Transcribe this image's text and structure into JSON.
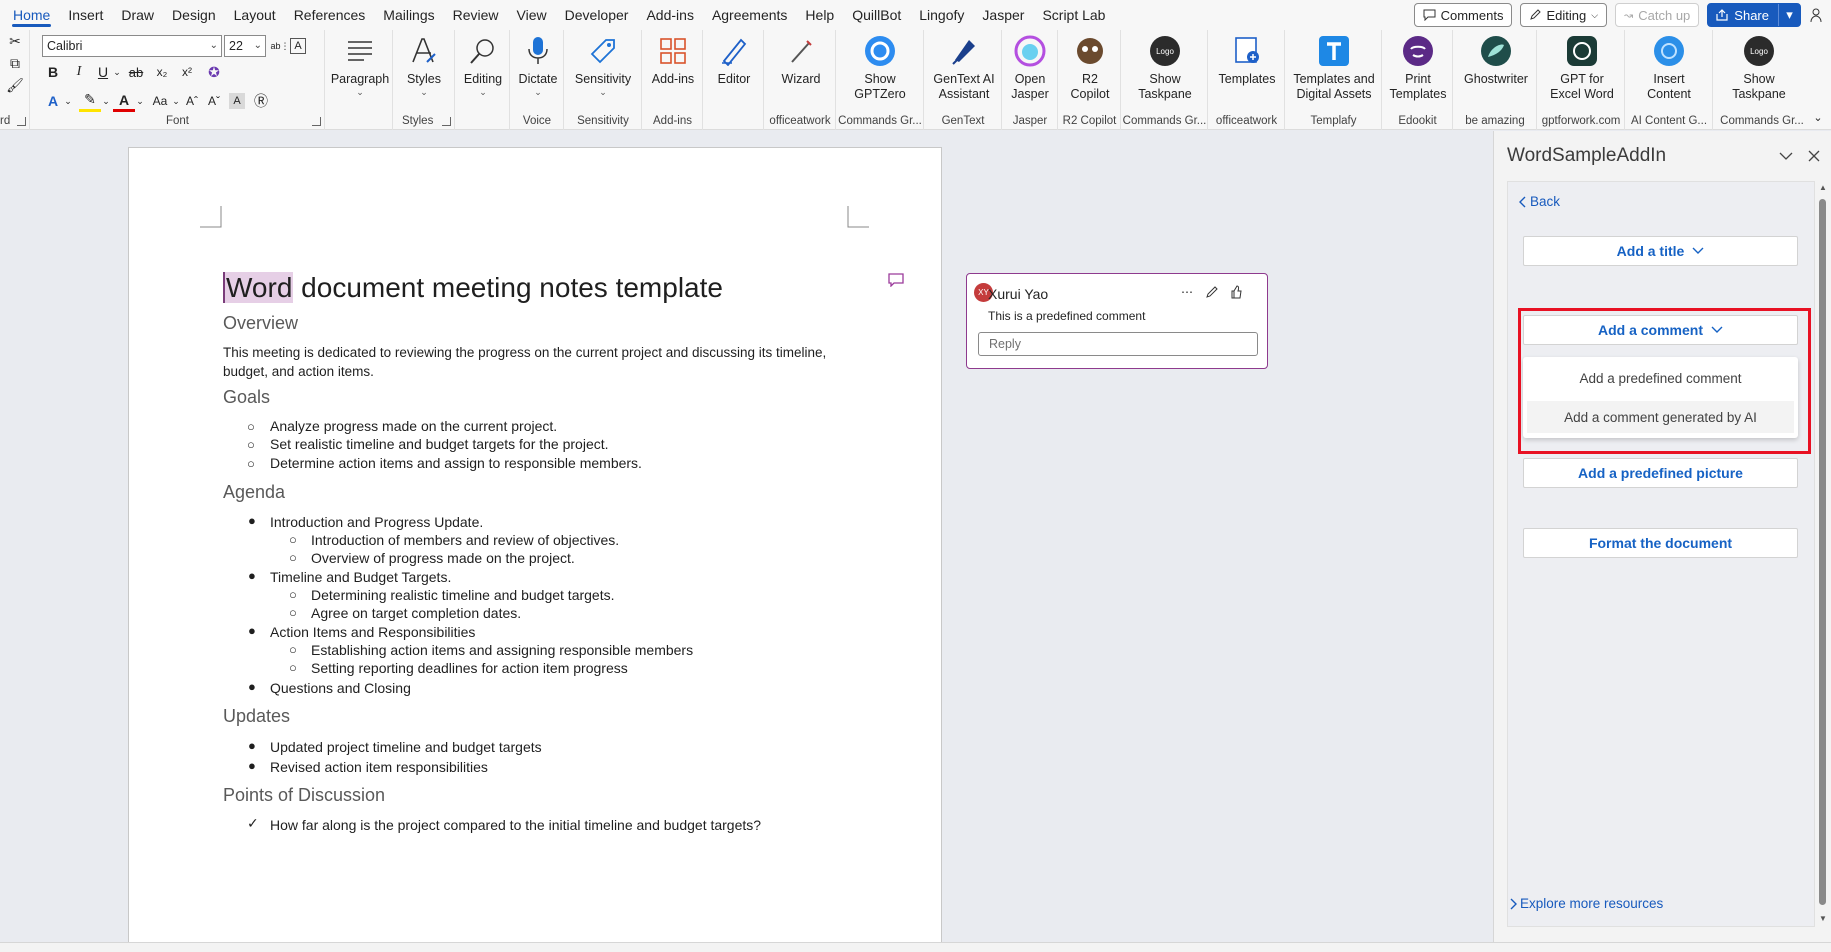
{
  "menu": {
    "tabs": [
      "Home",
      "Insert",
      "Draw",
      "Design",
      "Layout",
      "References",
      "Mailings",
      "Review",
      "View",
      "Developer",
      "Add-ins",
      "Agreements",
      "Help",
      "QuillBot",
      "Lingofy",
      "Jasper",
      "Script Lab"
    ],
    "active_tab": "Home",
    "comments_label": "Comments",
    "editing_label": "Editing",
    "catchup_label": "Catch up",
    "share_label": "Share"
  },
  "ribbon": {
    "font_name": "Calibri",
    "font_size": "22",
    "groups": {
      "clipboard": "rd",
      "font": "Font",
      "styles": "Styles",
      "voice": "Voice",
      "sensitivity": "Sensitivity",
      "addins": "Add-ins",
      "officeatwork1": "officeatwork",
      "commands1": "Commands Gr...",
      "gentext": "GenText",
      "jasper": "Jasper",
      "r2copilot": "R2 Copilot",
      "commands2": "Commands Gr...",
      "officeatwork2": "officeatwork",
      "templafy": "Templafy",
      "edookit": "Edookit",
      "beamazing": "be amazing",
      "gptforwork": "gptforwork.com",
      "aicontent": "AI Content G...",
      "commands3": "Commands Gr..."
    },
    "buttons": {
      "paragraph": "Paragraph",
      "styles": "Styles",
      "editing": "Editing",
      "dictate": "Dictate",
      "sensitivity": "Sensitivity",
      "addins": "Add-ins",
      "editor": "Editor",
      "wizard": "Wizard",
      "show_gptzero_1": "Show",
      "show_gptzero_2": "GPTZero",
      "gentext_1": "GenText AI",
      "gentext_2": "Assistant",
      "open_jasper_1": "Open",
      "open_jasper_2": "Jasper",
      "r2_1": "R2",
      "r2_2": "Copilot",
      "show_taskpane_1": "Show",
      "show_taskpane_2": "Taskpane",
      "templates": "Templates",
      "templates_digital_1": "Templates and",
      "templates_digital_2": "Digital Assets",
      "print_templates_1": "Print",
      "print_templates_2": "Templates",
      "ghostwriter": "Ghostwriter",
      "gpt_excel_1": "GPT for",
      "gpt_excel_2": "Excel Word",
      "insert_content_1": "Insert",
      "insert_content_2": "Content",
      "show_taskpane2_1": "Show",
      "show_taskpane2_2": "Taskpane",
      "logo_text": "Logo"
    }
  },
  "document": {
    "title_word": "Word",
    "title_rest": " document meeting notes template",
    "sections": {
      "overview": "Overview",
      "overview_text": "This meeting is dedicated to reviewing the progress on the current project and discussing its timeline, budget, and action items.",
      "goals": "Goals",
      "goals_items": [
        "Analyze progress made on the current project.",
        "Set realistic timeline and budget targets for the project.",
        "Determine action items and assign to responsible members."
      ],
      "agenda": "Agenda",
      "agenda_1": "Introduction and Progress Update.",
      "agenda_1a": "Introduction of members and review of objectives.",
      "agenda_1b": "Overview of progress made on the project.",
      "agenda_2": "Timeline and Budget Targets.",
      "agenda_2a": "Determining realistic timeline and budget targets.",
      "agenda_2b": "Agree on target completion dates.",
      "agenda_3": "Action Items and Responsibilities",
      "agenda_3a": "Establishing action items and assigning responsible members",
      "agenda_3b": "Setting reporting deadlines for action item progress",
      "agenda_4": "Questions and Closing",
      "updates": "Updates",
      "updates_items": [
        "Updated project timeline and budget targets",
        "Revised action item responsibilities"
      ],
      "discussion": "Points of Discussion",
      "discussion_1": "How far along is the project compared to the initial timeline and budget targets?"
    }
  },
  "comment": {
    "avatar": "XY",
    "author": "Xurui Yao",
    "text": "This is a predefined comment",
    "reply_placeholder": "Reply"
  },
  "taskpane": {
    "title": "WordSampleAddIn",
    "back": "Back",
    "add_title": "Add a title",
    "add_comment": "Add a comment",
    "dropdown_items": [
      "Add a predefined comment",
      "Add a comment generated by AI"
    ],
    "add_picture": "Add a predefined picture",
    "format_document": "Format the document",
    "explore": "Explore more resources"
  },
  "colors": {
    "accent": "#185abd",
    "highlight": "#e81123",
    "comment_border": "#8e3a8e"
  }
}
